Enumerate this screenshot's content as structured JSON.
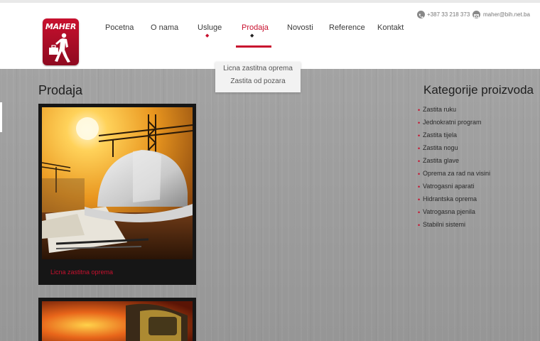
{
  "brand": {
    "logo_text": "MAHER",
    "accent_color": "#c8102e"
  },
  "nav": {
    "items": [
      {
        "label": "Pocetna",
        "has_submenu": false,
        "active": false
      },
      {
        "label": "O nama",
        "has_submenu": false,
        "active": false
      },
      {
        "label": "Usluge",
        "has_submenu": true,
        "active": false
      },
      {
        "label": "Prodaja",
        "has_submenu": true,
        "active": true
      },
      {
        "label": "Novosti",
        "has_submenu": false,
        "active": false
      },
      {
        "label": "Reference",
        "has_submenu": false,
        "active": false
      },
      {
        "label": "Kontakt",
        "has_submenu": false,
        "active": false
      }
    ],
    "dropdown": [
      "Licna zastitna oprema",
      "Zastita od pozara"
    ]
  },
  "contact": {
    "phone": "+387 33 218 373",
    "phone_icon": "phone-icon",
    "email": "maher@bih.net.ba",
    "email_icon": "envelope-icon"
  },
  "main": {
    "title": "Prodaja",
    "cards": [
      {
        "caption": "Licna zastitna oprema",
        "image": "helmet-crane-photo"
      },
      {
        "caption": "",
        "image": "firefighter-flames-photo"
      }
    ]
  },
  "sidebar": {
    "title": "Kategorije proizvoda",
    "categories": [
      "Zastita ruku",
      "Jednokratni program",
      "Zastita tijela",
      "Zastita nogu",
      "Zastita glave",
      "Oprema za rad na visini",
      "Vatrogasni aparati",
      "Hidrantska oprema",
      "Vatrogasna pjenila",
      "Stabilni sistemi"
    ]
  }
}
